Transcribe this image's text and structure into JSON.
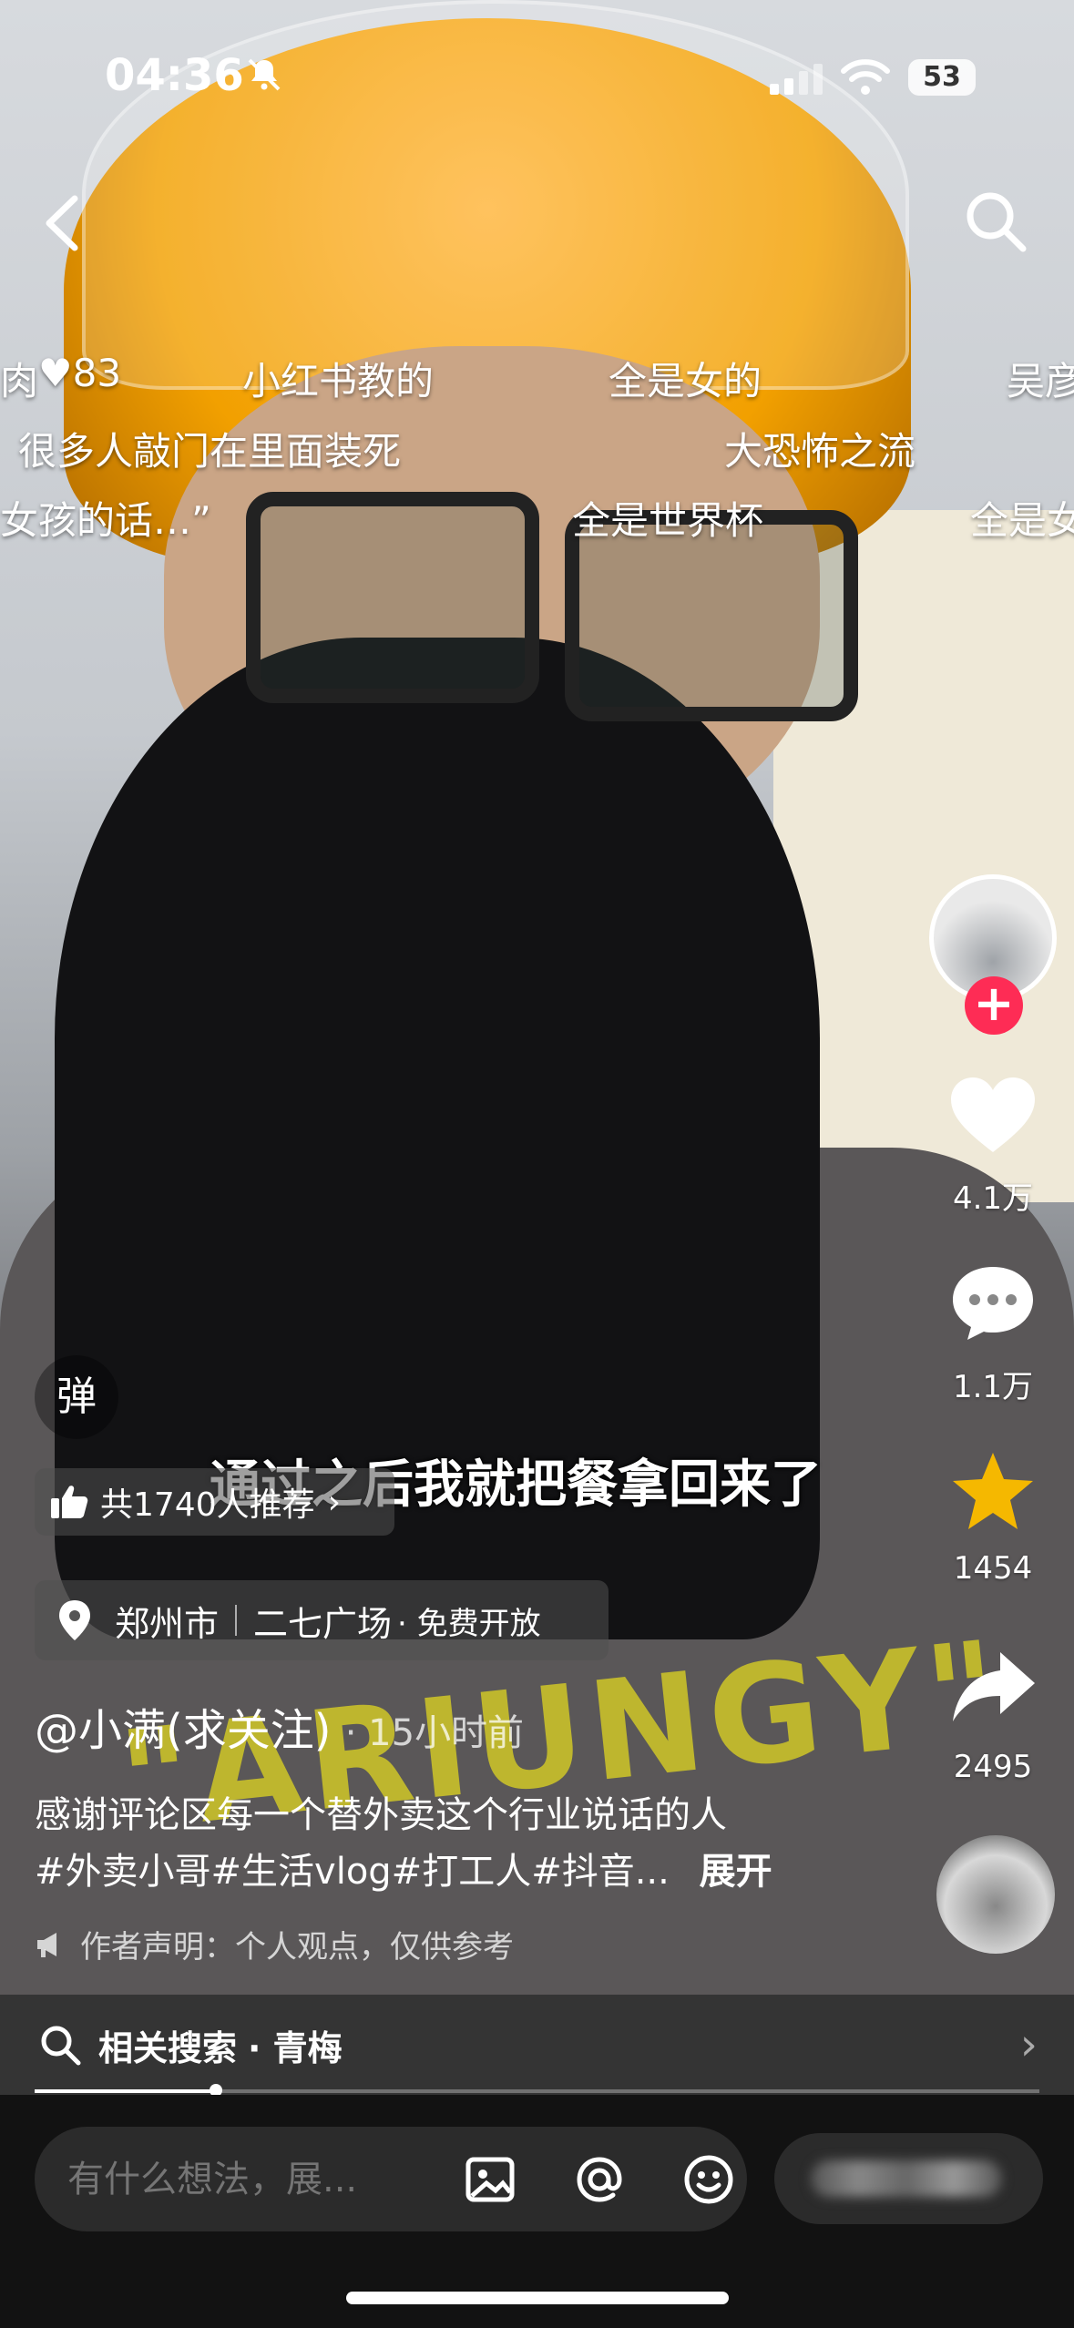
{
  "status_bar": {
    "time": "04:36",
    "battery": "53"
  },
  "danmu": [
    {
      "text": "肉"
    },
    {
      "text": "♥83"
    },
    {
      "text": "小红书教的"
    },
    {
      "text": "全是女的"
    },
    {
      "text": "吴彦"
    },
    {
      "text": "很多人敲门在里面装死"
    },
    {
      "text": "大恐怖之流"
    },
    {
      "text": "女孩的话…”"
    },
    {
      "text": "全是世界杯"
    },
    {
      "text": "全是女"
    }
  ],
  "caption": "通过之后我就把餐拿回来了",
  "danmu_button": "弹",
  "recommend": {
    "label": "共1740人推荐"
  },
  "location": {
    "city": "郑州市",
    "place": "二七广场",
    "tag": "· 免费开放"
  },
  "author": {
    "name": "@小满(求关注)",
    "time_ago": "· 15小时前"
  },
  "description": {
    "line1": "感谢评论区每一个替外卖这个行业说话的人",
    "line2": "#外卖小哥#生活vlog#打工人#抖音...",
    "more": "展开"
  },
  "notice": "作者声明：个人观点，仅供参考",
  "related_search": {
    "label": "相关搜索",
    "query": "· 青梅"
  },
  "progress": {
    "fraction": 0.18
  },
  "right_rail": {
    "likes": "4.1万",
    "comments": "1.1万",
    "favorites": "1454",
    "shares": "2495",
    "follow_symbol": "+"
  },
  "comment_bar": {
    "placeholder": "有什么想法，展..."
  },
  "shirt_print": "\"ARIUNGY\"",
  "colors": {
    "accent": "#fe2c55",
    "star": "#f5b800",
    "helmet": "#f2a000"
  }
}
